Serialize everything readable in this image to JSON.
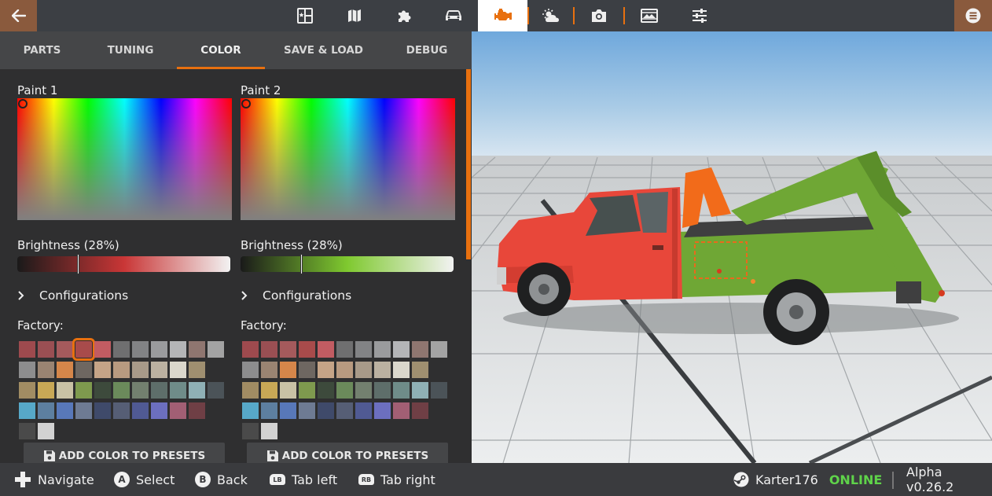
{
  "topbar": {
    "icons": [
      "back-arrow-icon",
      "scenario-icon",
      "map-icon",
      "parts-puzzle-icon",
      "car-icon",
      "engine-icon",
      "weather-icon",
      "camera-icon",
      "photo-mode-icon",
      "settings-sliders-icon",
      "menu-icon"
    ],
    "active_icon": "engine-icon",
    "accent": "#e8700f"
  },
  "tabs": [
    {
      "label": "PARTS"
    },
    {
      "label": "TUNING"
    },
    {
      "label": "COLOR"
    },
    {
      "label": "SAVE & LOAD"
    },
    {
      "label": "DEBUG"
    }
  ],
  "active_tab": "COLOR",
  "paint1": {
    "title": "Paint 1",
    "brightness_label": "Brightness (28%)",
    "brightness": 0.28,
    "brightness_color": "#c93636",
    "configurations": "Configurations",
    "factory_label": "Factory:",
    "add_preset": "ADD COLOR TO PRESETS"
  },
  "paint2": {
    "title": "Paint 2",
    "brightness_label": "Brightness (28%)",
    "brightness": 0.28,
    "brightness_color": "#7fc92f",
    "configurations": "Configurations",
    "factory_label": "Factory:",
    "add_preset": "ADD COLOR TO PRESETS"
  },
  "swatch_rows": [
    [
      "#9e4a4e",
      "#9a4f53",
      "#a55a5c",
      "#a84b4b",
      "#c25c62",
      "#6f6f70",
      "#828385",
      "#9a9b9d",
      "#b4b5b7",
      "#8f7670",
      "#a3a3a3"
    ],
    [
      "#8d8d8e",
      "#9a8472",
      "#d5864a",
      "#6e6761",
      "#c5a487",
      "#b89a80",
      "#a89a89",
      "#bbb1a1",
      "#dad7cc",
      "#9f8f70"
    ],
    [
      "#a18c63",
      "#c8a856",
      "#c9c2a5",
      "#7e9a4e",
      "#3d4a3c",
      "#6b8a5b",
      "#73806f",
      "#5e6e6a",
      "#6f8c89",
      "#8fb0b5",
      "#4b5358"
    ],
    [
      "#57a8c8",
      "#5d7fa0",
      "#5878b9",
      "#6e7b93",
      "#3f4a6a",
      "#565e75",
      "#505a93",
      "#6c6fbf",
      "#a25f74",
      "#6f3f45"
    ],
    [
      "#4a4a4a",
      "#d2d2d2"
    ]
  ],
  "selected_swatch": "paint1-row1-col4",
  "viewport": {
    "paint1_color": "#e8473a",
    "paint2_color": "#6fa735",
    "towbar_color": "#f26b1a"
  },
  "bottombar": {
    "hints": [
      {
        "glyph": "dpad-icon",
        "label": "Navigate"
      },
      {
        "glyph": "A",
        "label": "Select"
      },
      {
        "glyph": "B",
        "label": "Back"
      },
      {
        "glyph": "LB",
        "label": "Tab left"
      },
      {
        "glyph": "RB",
        "label": "Tab right"
      }
    ],
    "username": "Karter176",
    "status": "ONLINE",
    "version": "Alpha v0.26.2"
  }
}
